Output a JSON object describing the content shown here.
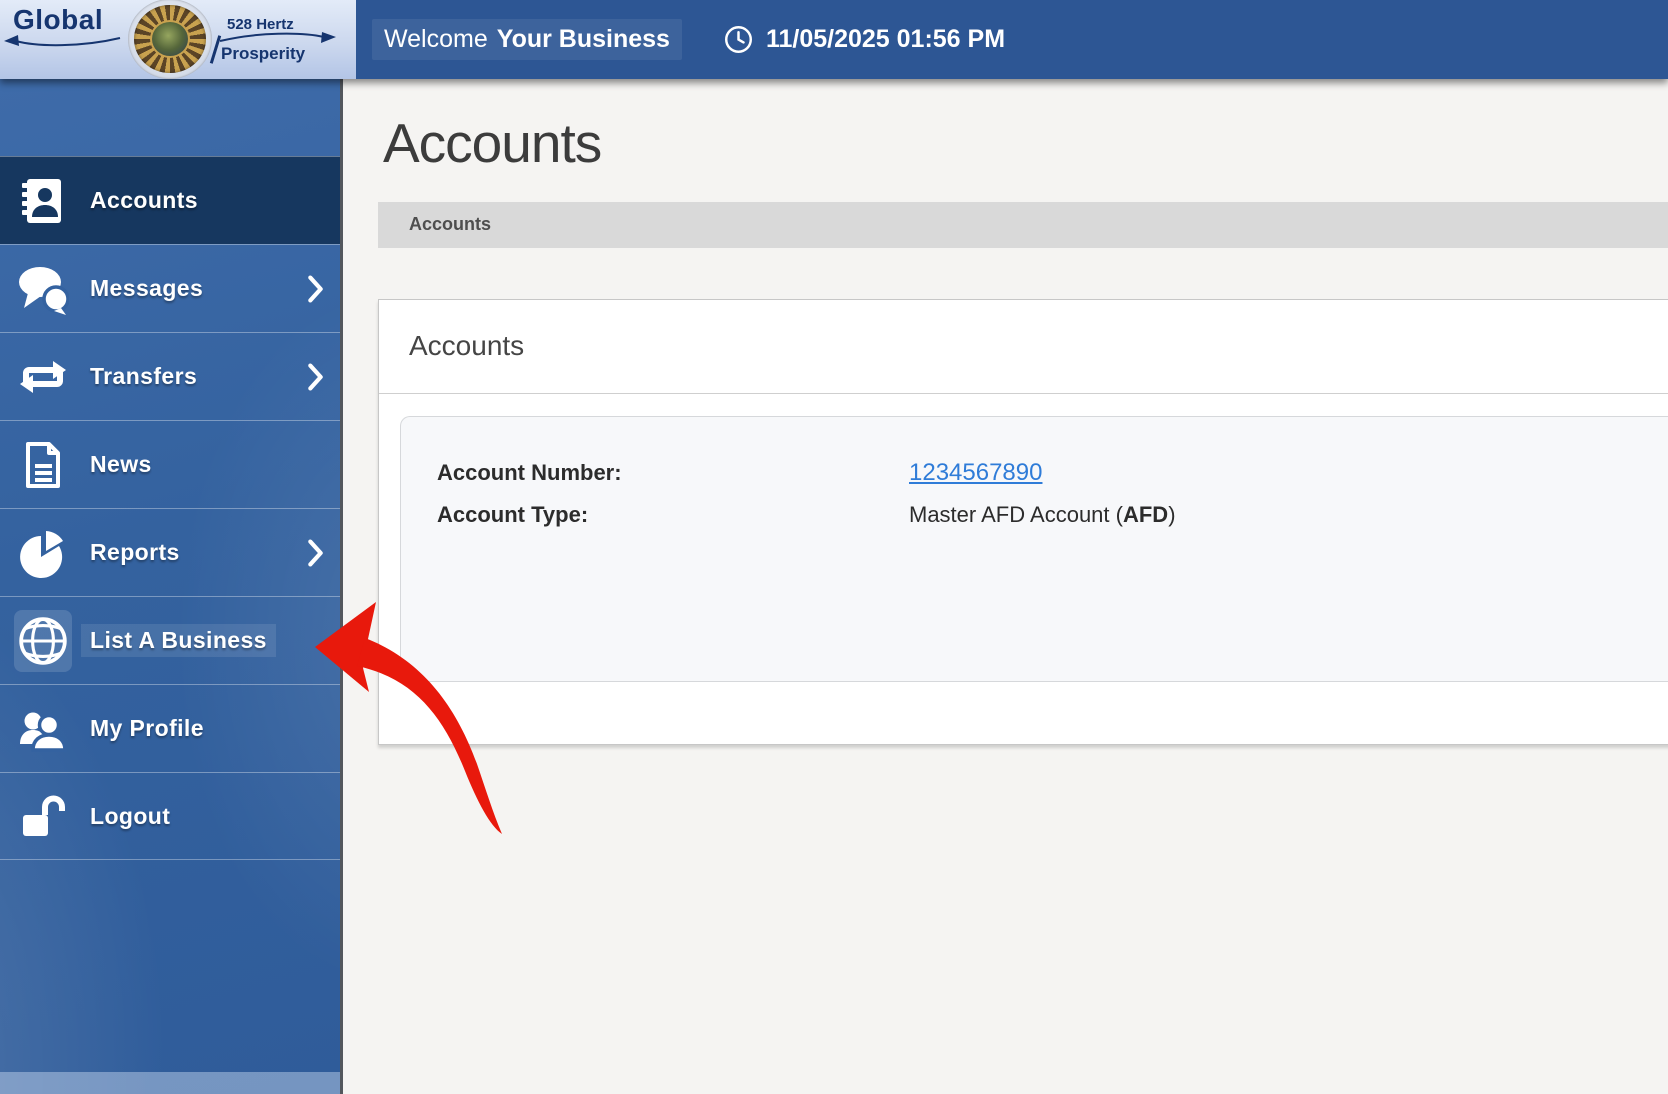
{
  "logo": {
    "name_primary": "Global",
    "tagline_line1": "528 Hertz",
    "tagline_line2": "Prosperity"
  },
  "header": {
    "welcome_label": "Welcome",
    "account_name": "Your Business",
    "datetime": "11/05/2025 01:56 PM"
  },
  "sidebar": {
    "items": [
      {
        "label": "Accounts",
        "icon": "address-book-icon",
        "active": true,
        "has_submenu": false
      },
      {
        "label": "Messages",
        "icon": "chat-bubbles-icon",
        "active": false,
        "has_submenu": true
      },
      {
        "label": "Transfers",
        "icon": "transfer-arrows-icon",
        "active": false,
        "has_submenu": true
      },
      {
        "label": "News",
        "icon": "document-icon",
        "active": false,
        "has_submenu": false
      },
      {
        "label": "Reports",
        "icon": "pie-chart-icon",
        "active": false,
        "has_submenu": true
      },
      {
        "label": "List A Business",
        "icon": "globe-icon",
        "active": false,
        "has_submenu": false,
        "highlighted": true
      },
      {
        "label": "My Profile",
        "icon": "users-icon",
        "active": false,
        "has_submenu": false
      },
      {
        "label": "Logout",
        "icon": "open-padlock-icon",
        "active": false,
        "has_submenu": false
      }
    ]
  },
  "main": {
    "page_title": "Accounts",
    "breadcrumb": "Accounts",
    "panel_title": "Accounts",
    "account": {
      "number_label": "Account Number:",
      "account_number": "1234567890",
      "type_label": "Account Type:",
      "type_value_prefix": "Master AFD Account (",
      "type_value_bold": "AFD",
      "type_value_suffix": ")"
    }
  },
  "annotation": {
    "arrow_points_to": "List A Business",
    "arrow_color": "#e8190c"
  },
  "colors": {
    "header_blue": "#2d5694",
    "sidebar_blue": "#3462a0",
    "active_item_blue": "#16375f",
    "link_blue": "#2f7cd8",
    "arrow_red": "#e8190c",
    "breadcrumb_bg": "#d9d9d9",
    "logo_navy": "#16356f"
  }
}
